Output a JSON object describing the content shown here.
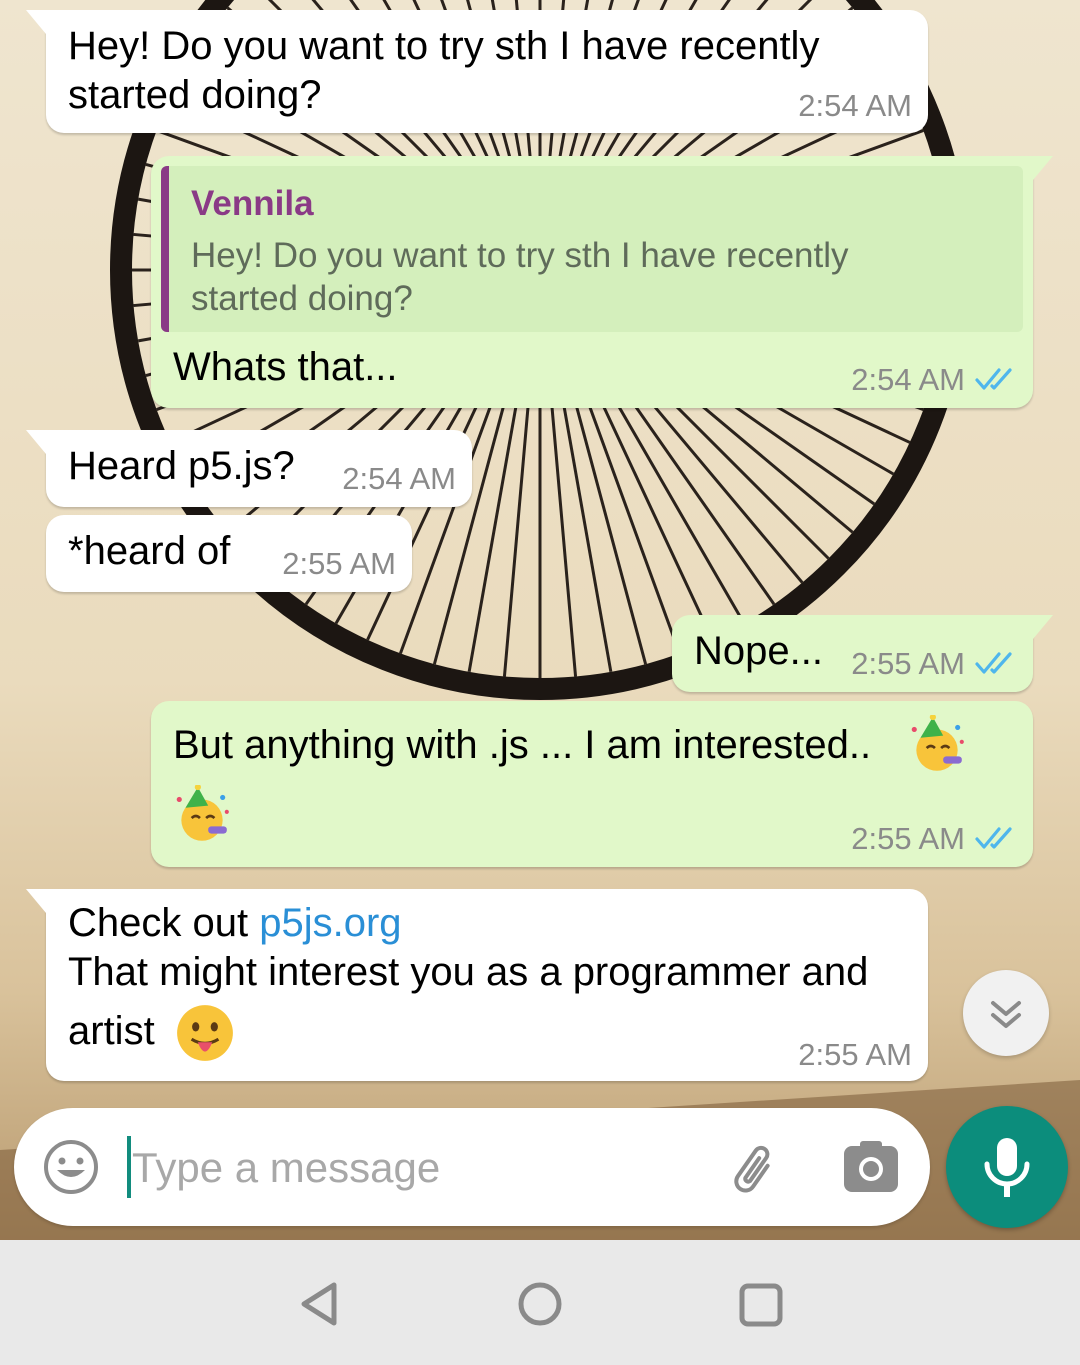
{
  "messages": [
    {
      "text": "Hey! Do you want to try sth I have recently",
      "text2": "started doing?",
      "time": "2:54 AM"
    },
    {
      "quote_name": "Vennila",
      "quote_line1": "Hey! Do you want to try sth I have recently",
      "quote_line2": "started doing?",
      "text": "Whats that...",
      "time": "2:54 AM"
    },
    {
      "text": "Heard p5.js?",
      "time": "2:54 AM"
    },
    {
      "text": "*heard of",
      "time": "2:55 AM"
    },
    {
      "text": "Nope...",
      "time": "2:55 AM"
    },
    {
      "text": "But anything with .js ... I am interested..",
      "time": "2:55 AM"
    },
    {
      "text_prefix": "Check out ",
      "link": "p5js.org",
      "text2": "That might interest you as a programmer and",
      "text3": "artist",
      "time": "2:55 AM"
    }
  ],
  "input": {
    "placeholder": "Type a message"
  },
  "icons": {
    "read_receipt": "double-check-icon",
    "emoji_button": "emoji-icon",
    "attach": "paperclip-icon",
    "camera": "camera-icon",
    "mic": "mic-icon",
    "scroll_down": "chevron-double-down-icon",
    "nav_back": "triangle-back-icon",
    "nav_home": "circle-home-icon",
    "nav_recents": "square-recents-icon",
    "party_emoji": "partying-face-emoji",
    "tongue_emoji": "tongue-out-emoji"
  },
  "colors": {
    "incoming_bubble": "#ffffff",
    "outgoing_bubble": "#e1f8c9",
    "quote_accent": "#8a3a86",
    "read_tick": "#4fb6ec",
    "link": "#2a8fd6",
    "mic_button": "#0c8d7c"
  }
}
